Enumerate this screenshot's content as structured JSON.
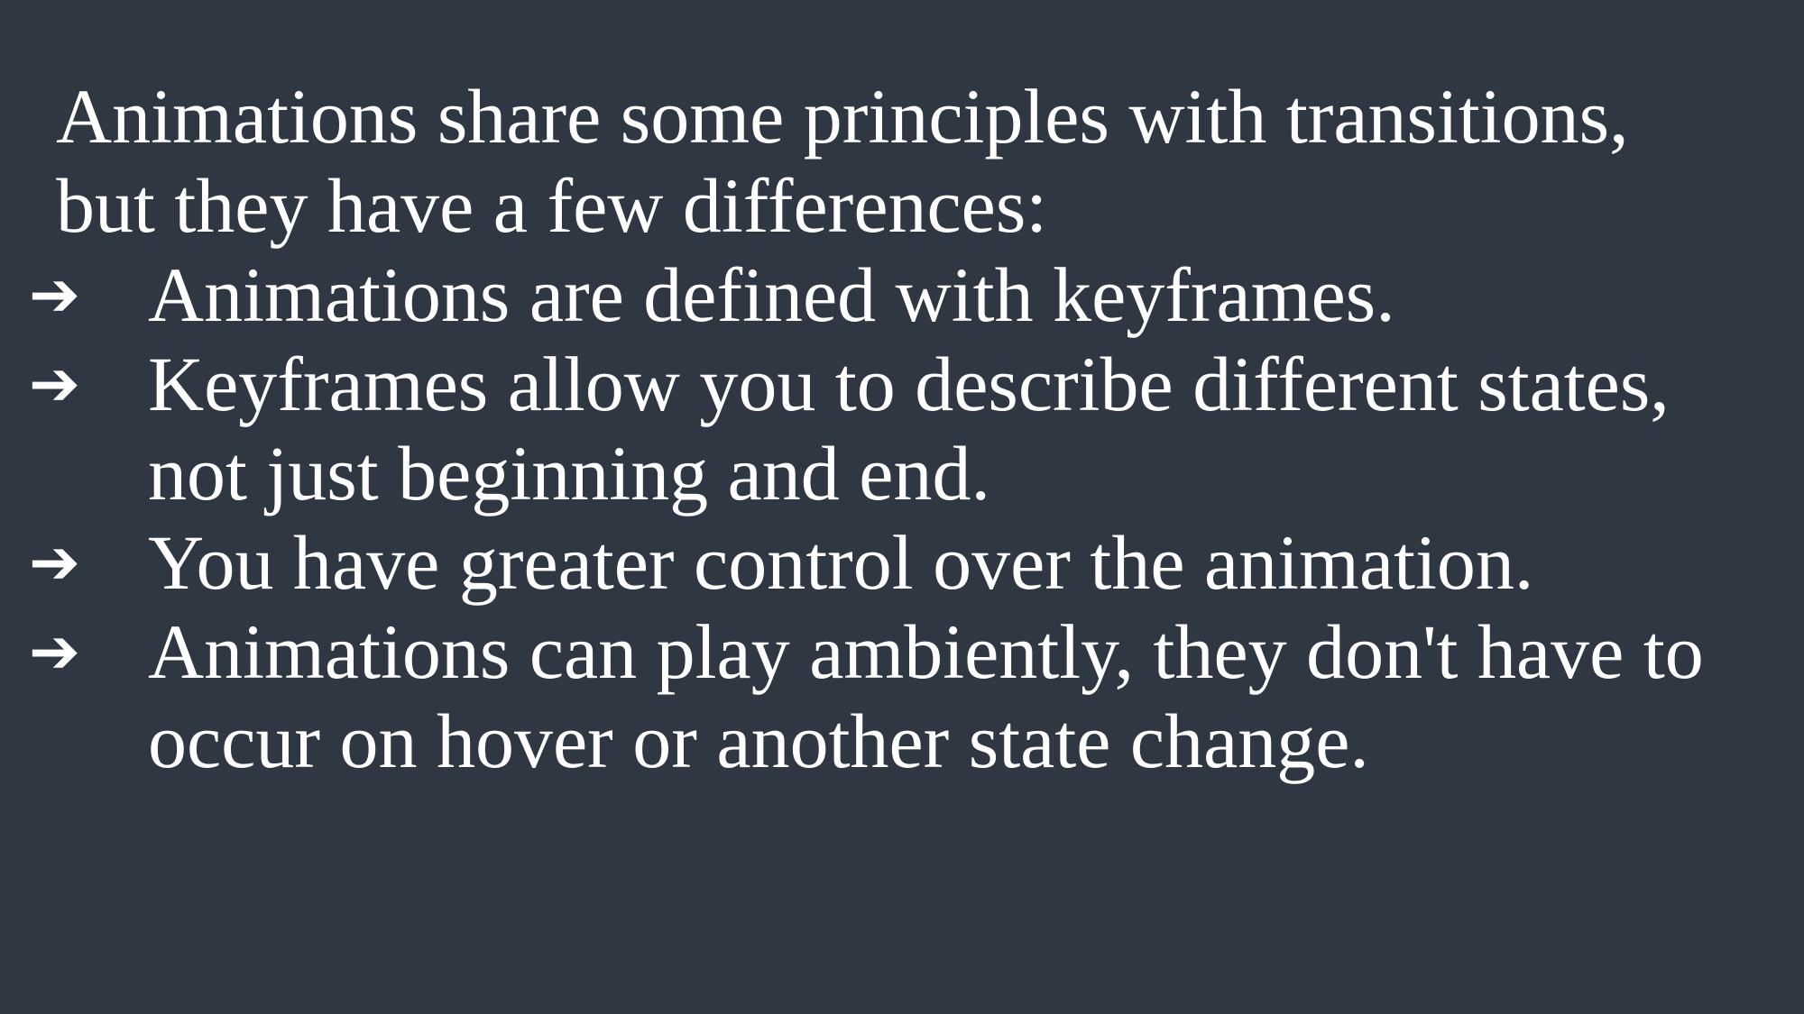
{
  "slide": {
    "intro": "Animations share some principles with transitions, but they have a few differences:",
    "bullet_icon": "arrow-right-icon",
    "bullet_glyph": "➔",
    "bullets": [
      "Animations are defined with keyframes.",
      "Keyframes allow you to describe different states, not just beginning and end.",
      "You have greater control over the animation.",
      "Animations can play ambiently, they don't have to occur on hover or another state change."
    ]
  },
  "colors": {
    "background": "#2f3742",
    "text": "#ffffff"
  }
}
